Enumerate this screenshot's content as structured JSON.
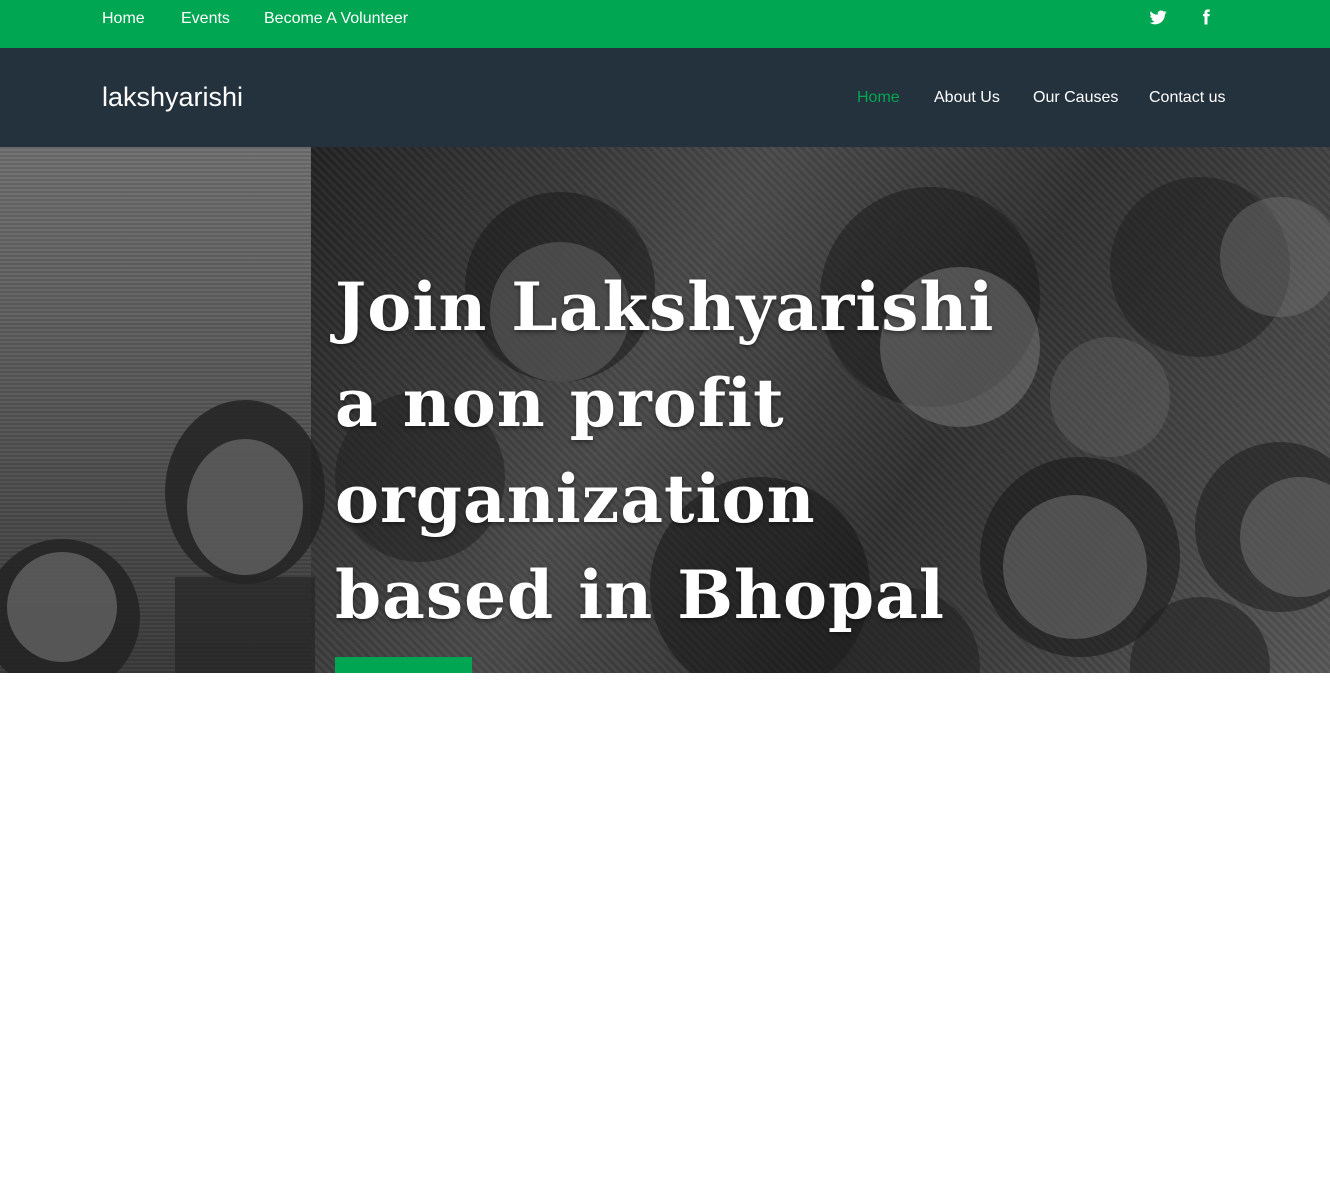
{
  "topbar": {
    "links": [
      "Home",
      "Events",
      "Become A Volunteer"
    ],
    "social": {
      "twitter_icon": "twitter-icon",
      "facebook_icon": "facebook-icon"
    },
    "color": "#00a651"
  },
  "navbar": {
    "brand": "lakshyarishi",
    "links": [
      "Home",
      "About Us",
      "Our Causes",
      "Contact us"
    ],
    "active_link": "Home",
    "background": "#24323d",
    "active_color": "#00a651"
  },
  "hero": {
    "title": "Join Lakshyarishi a non profit organization based in Bhopal",
    "button_color": "#00a651"
  }
}
